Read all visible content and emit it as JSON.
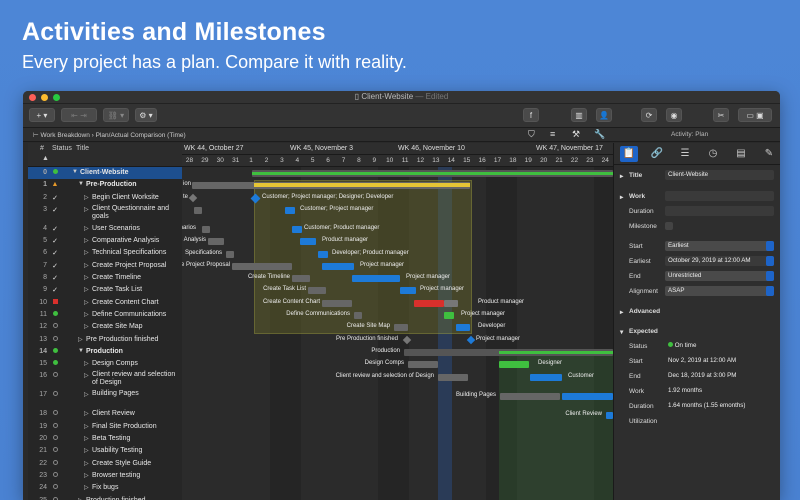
{
  "headline": "Activities and Milestones",
  "subhead": "Every project has a plan. Compare it with reality.",
  "window": {
    "title": "Client-Website",
    "edited": "— Edited"
  },
  "subbar": {
    "crumb1": "Work Breakdown",
    "crumb2": "Plan/Actual Comparison (Time)",
    "activity": "Activity: Plan"
  },
  "outline": {
    "headers": {
      "num": "#",
      "status": "Status",
      "title": "Title"
    },
    "rows": [
      {
        "n": "0",
        "status": "green",
        "title": "Client-Website",
        "indent": 0,
        "bold": true,
        "sel": true,
        "tri": "down"
      },
      {
        "n": "1",
        "status": "warn",
        "title": "Pre-Production",
        "indent": 1,
        "bold": true,
        "tri": "down"
      },
      {
        "n": "2",
        "status": "check",
        "title": "Begin Client Worksite",
        "indent": 2,
        "tri": "right"
      },
      {
        "n": "3",
        "status": "check",
        "title": "Client Questionnaire and goals",
        "indent": 2,
        "tri": "right",
        "tall": true
      },
      {
        "n": "4",
        "status": "check",
        "title": "User Scenarios",
        "indent": 2,
        "tri": "right"
      },
      {
        "n": "5",
        "status": "check",
        "title": "Comparative Analysis",
        "indent": 2,
        "tri": "right"
      },
      {
        "n": "6",
        "status": "check",
        "title": "Technical Specifications",
        "indent": 2,
        "tri": "right"
      },
      {
        "n": "7",
        "status": "check",
        "title": "Create Project Proposal",
        "indent": 2,
        "tri": "right"
      },
      {
        "n": "8",
        "status": "check",
        "title": "Create Timeline",
        "indent": 2,
        "tri": "right"
      },
      {
        "n": "9",
        "status": "check",
        "title": "Create Task List",
        "indent": 2,
        "tri": "right"
      },
      {
        "n": "10",
        "status": "red",
        "title": "Create Content Chart",
        "indent": 2,
        "tri": "right"
      },
      {
        "n": "11",
        "status": "green",
        "title": "Define Communications",
        "indent": 2,
        "tri": "right"
      },
      {
        "n": "12",
        "status": "empty",
        "title": "Create Site Map",
        "indent": 2,
        "tri": "right"
      },
      {
        "n": "13",
        "status": "empty",
        "title": "Pre Production finished",
        "indent": 1,
        "tri": "right"
      },
      {
        "n": "14",
        "status": "green",
        "title": "Production",
        "indent": 1,
        "bold": true,
        "tri": "down"
      },
      {
        "n": "15",
        "status": "green",
        "title": "Design Comps",
        "indent": 2,
        "tri": "right"
      },
      {
        "n": "16",
        "status": "empty",
        "title": "Client review and selection of Design",
        "indent": 2,
        "tri": "right",
        "tall": true
      },
      {
        "n": "17",
        "status": "empty",
        "title": "Building Pages",
        "indent": 2,
        "tri": "right",
        "tall": true
      },
      {
        "n": "18",
        "status": "empty",
        "title": "Client Review",
        "indent": 2,
        "tri": "right"
      },
      {
        "n": "19",
        "status": "empty",
        "title": "Final Site Production",
        "indent": 2,
        "tri": "right"
      },
      {
        "n": "20",
        "status": "empty",
        "title": "Beta Testing",
        "indent": 2,
        "tri": "right"
      },
      {
        "n": "21",
        "status": "empty",
        "title": "Usability Testing",
        "indent": 2,
        "tri": "right"
      },
      {
        "n": "22",
        "status": "empty",
        "title": "Create Style Guide",
        "indent": 2,
        "tri": "right"
      },
      {
        "n": "23",
        "status": "empty",
        "title": "Browser testing",
        "indent": 2,
        "tri": "right"
      },
      {
        "n": "24",
        "status": "empty",
        "title": "Fix bugs",
        "indent": 2,
        "tri": "right"
      },
      {
        "n": "25",
        "status": "empty",
        "title": "Production finished",
        "indent": 1,
        "tri": "right"
      }
    ]
  },
  "gantt": {
    "weeks": [
      "WK 44, October 27",
      "WK 45, November 3",
      "WK 46, November 10",
      "WK 47, November 17",
      "WK 48"
    ],
    "days": [
      "28",
      "29",
      "30",
      "31",
      "1",
      "2",
      "3",
      "4",
      "5",
      "6",
      "7",
      "8",
      "9",
      "10",
      "11",
      "12",
      "13",
      "14",
      "15",
      "16",
      "17",
      "18",
      "19",
      "20",
      "21",
      "22",
      "23",
      "24",
      "25"
    ],
    "labels": {
      "l2": "Customer; Project manager; Designer; Developer",
      "l3": "Customer; Project manager",
      "l4": "Customer; Product manager",
      "l5": "Product manager",
      "l6": "Developer; Product manager",
      "l7": "Project manager",
      "l8": "Project manager",
      "l9": "Project manager",
      "l10": "Product manager",
      "l11": "Project manager",
      "l12": "Developer",
      "l13": "Project manager",
      "left3": "te",
      "left4": "narios",
      "left5": "e Analysis",
      "left6": "Specifications",
      "left7": "e Project Proposal",
      "left8": "Create Timeline",
      "left9": "Create Task List",
      "left10": "Create Content Chart",
      "left11": "Define Communications",
      "left12": "Create Site Map",
      "left13": "Pre Production finished",
      "left14": "Production",
      "left15": "Design Comps",
      "left16": "Client review and selection of Design",
      "left17": "Building Pages",
      "left18": "Client Review",
      "r15": "Designer",
      "r16": "Customer",
      "pfx1": "ion",
      "pfx2": "te"
    }
  },
  "inspector": {
    "title_label": "Title",
    "title_value": "Client-Website",
    "work_label": "Work",
    "duration_label": "Duration",
    "milestone_label": "Milestone",
    "start_label": "Start",
    "start_value": "Earliest",
    "earliest_label": "Earliest",
    "earliest_value": "October 29, 2019 at 12:00 AM",
    "end_label": "End",
    "end_value": "Unrestricted",
    "align_label": "Alignment",
    "align_value": "ASAP",
    "advanced": "Advanced",
    "expected": "Expected",
    "status_label": "Status",
    "status_value": "On time",
    "estart_label": "Start",
    "estart_value": "Nov 2, 2019 at 12:00 AM",
    "eend_label": "End",
    "eend_value": "Dec 18, 2019 at 3:00 PM",
    "ework_label": "Work",
    "ework_value": "1.92 months",
    "edur_label": "Duration",
    "edur_value": "1.64 months (1.55 emonths)",
    "util_label": "Utilization"
  },
  "colors": {
    "accent": "#1d64c9",
    "green": "#3fbf3f",
    "red": "#d9302c",
    "warn": "#e89a2a"
  }
}
